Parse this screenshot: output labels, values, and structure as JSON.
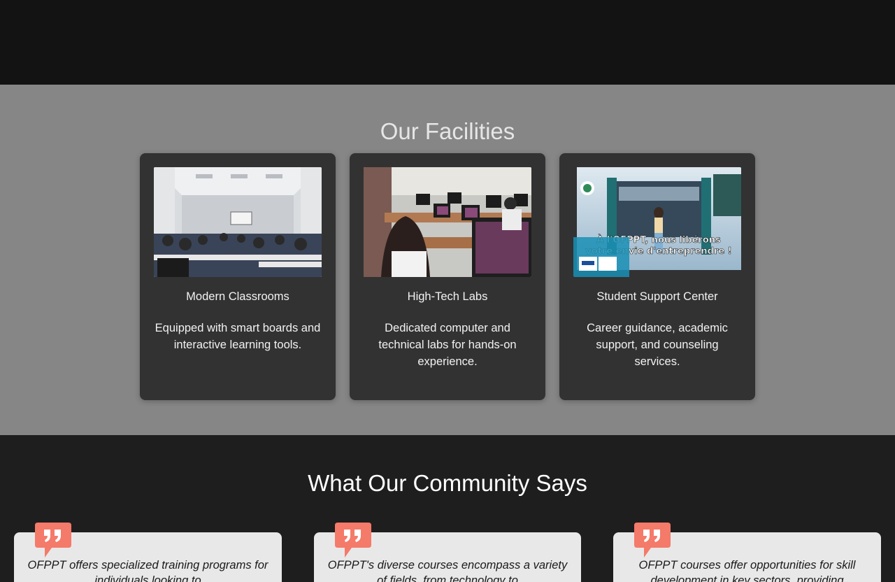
{
  "facilities": {
    "heading": "Our Facilities",
    "cards": [
      {
        "title": "Modern Classrooms",
        "description": "Equipped with smart boards and interactive learning tools.",
        "image_alt": "classroom photo"
      },
      {
        "title": "High-Tech Labs",
        "description": "Dedicated computer and technical labs for hands-on experience.",
        "image_alt": "computer lab photo"
      },
      {
        "title": "Student Support Center",
        "description": "Career guidance, academic support, and counseling services.",
        "image_alt": "OFPPT poster",
        "poster_text_line1": "À l'OFPPT, nous libérons",
        "poster_text_line2": "votre envie d'entreprendre !"
      }
    ]
  },
  "community": {
    "heading": "What Our Community Says",
    "testimonials": [
      {
        "quote": "OFPPT offers specialized training programs for individuals looking to"
      },
      {
        "quote": "OFPPT's diverse courses encompass a variety of fields, from technology to"
      },
      {
        "quote": "OFPPT courses offer opportunities for skill development in key sectors, providing"
      }
    ]
  },
  "colors": {
    "top_band": "#131313",
    "facilities_bg": "#868686",
    "card_bg": "#323232",
    "community_bg": "#1e1e1e",
    "testimonial_bg": "#e8e8e8",
    "quote_accent": "#f47a6a"
  },
  "icons": {
    "quote": "quote-icon"
  }
}
